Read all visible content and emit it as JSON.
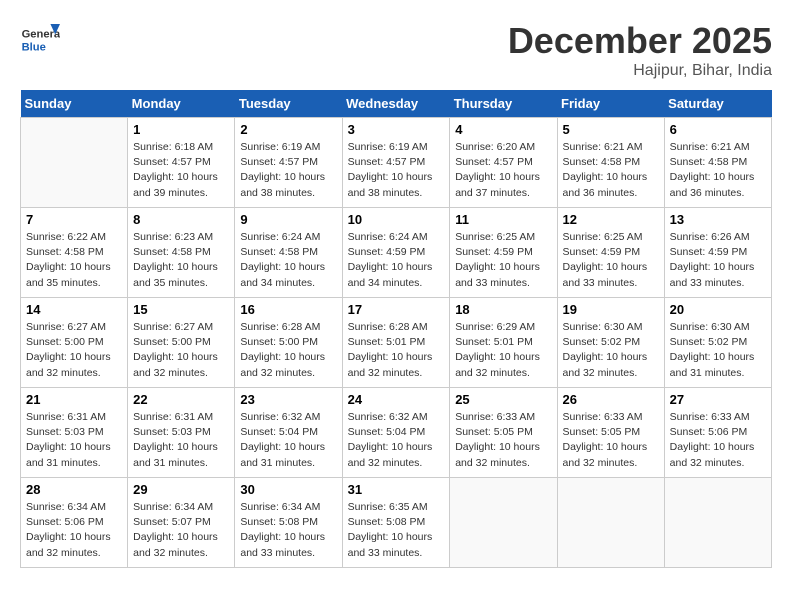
{
  "header": {
    "logo_line1": "General",
    "logo_line2": "Blue",
    "month": "December 2025",
    "location": "Hajipur, Bihar, India"
  },
  "weekdays": [
    "Sunday",
    "Monday",
    "Tuesday",
    "Wednesday",
    "Thursday",
    "Friday",
    "Saturday"
  ],
  "weeks": [
    [
      {
        "day": null
      },
      {
        "day": "1",
        "sunrise": "6:18 AM",
        "sunset": "4:57 PM",
        "daylight": "10 hours and 39 minutes."
      },
      {
        "day": "2",
        "sunrise": "6:19 AM",
        "sunset": "4:57 PM",
        "daylight": "10 hours and 38 minutes."
      },
      {
        "day": "3",
        "sunrise": "6:19 AM",
        "sunset": "4:57 PM",
        "daylight": "10 hours and 38 minutes."
      },
      {
        "day": "4",
        "sunrise": "6:20 AM",
        "sunset": "4:57 PM",
        "daylight": "10 hours and 37 minutes."
      },
      {
        "day": "5",
        "sunrise": "6:21 AM",
        "sunset": "4:58 PM",
        "daylight": "10 hours and 36 minutes."
      },
      {
        "day": "6",
        "sunrise": "6:21 AM",
        "sunset": "4:58 PM",
        "daylight": "10 hours and 36 minutes."
      }
    ],
    [
      {
        "day": "7",
        "sunrise": "6:22 AM",
        "sunset": "4:58 PM",
        "daylight": "10 hours and 35 minutes."
      },
      {
        "day": "8",
        "sunrise": "6:23 AM",
        "sunset": "4:58 PM",
        "daylight": "10 hours and 35 minutes."
      },
      {
        "day": "9",
        "sunrise": "6:24 AM",
        "sunset": "4:58 PM",
        "daylight": "10 hours and 34 minutes."
      },
      {
        "day": "10",
        "sunrise": "6:24 AM",
        "sunset": "4:59 PM",
        "daylight": "10 hours and 34 minutes."
      },
      {
        "day": "11",
        "sunrise": "6:25 AM",
        "sunset": "4:59 PM",
        "daylight": "10 hours and 33 minutes."
      },
      {
        "day": "12",
        "sunrise": "6:25 AM",
        "sunset": "4:59 PM",
        "daylight": "10 hours and 33 minutes."
      },
      {
        "day": "13",
        "sunrise": "6:26 AM",
        "sunset": "4:59 PM",
        "daylight": "10 hours and 33 minutes."
      }
    ],
    [
      {
        "day": "14",
        "sunrise": "6:27 AM",
        "sunset": "5:00 PM",
        "daylight": "10 hours and 32 minutes."
      },
      {
        "day": "15",
        "sunrise": "6:27 AM",
        "sunset": "5:00 PM",
        "daylight": "10 hours and 32 minutes."
      },
      {
        "day": "16",
        "sunrise": "6:28 AM",
        "sunset": "5:00 PM",
        "daylight": "10 hours and 32 minutes."
      },
      {
        "day": "17",
        "sunrise": "6:28 AM",
        "sunset": "5:01 PM",
        "daylight": "10 hours and 32 minutes."
      },
      {
        "day": "18",
        "sunrise": "6:29 AM",
        "sunset": "5:01 PM",
        "daylight": "10 hours and 32 minutes."
      },
      {
        "day": "19",
        "sunrise": "6:30 AM",
        "sunset": "5:02 PM",
        "daylight": "10 hours and 32 minutes."
      },
      {
        "day": "20",
        "sunrise": "6:30 AM",
        "sunset": "5:02 PM",
        "daylight": "10 hours and 31 minutes."
      }
    ],
    [
      {
        "day": "21",
        "sunrise": "6:31 AM",
        "sunset": "5:03 PM",
        "daylight": "10 hours and 31 minutes."
      },
      {
        "day": "22",
        "sunrise": "6:31 AM",
        "sunset": "5:03 PM",
        "daylight": "10 hours and 31 minutes."
      },
      {
        "day": "23",
        "sunrise": "6:32 AM",
        "sunset": "5:04 PM",
        "daylight": "10 hours and 31 minutes."
      },
      {
        "day": "24",
        "sunrise": "6:32 AM",
        "sunset": "5:04 PM",
        "daylight": "10 hours and 32 minutes."
      },
      {
        "day": "25",
        "sunrise": "6:33 AM",
        "sunset": "5:05 PM",
        "daylight": "10 hours and 32 minutes."
      },
      {
        "day": "26",
        "sunrise": "6:33 AM",
        "sunset": "5:05 PM",
        "daylight": "10 hours and 32 minutes."
      },
      {
        "day": "27",
        "sunrise": "6:33 AM",
        "sunset": "5:06 PM",
        "daylight": "10 hours and 32 minutes."
      }
    ],
    [
      {
        "day": "28",
        "sunrise": "6:34 AM",
        "sunset": "5:06 PM",
        "daylight": "10 hours and 32 minutes."
      },
      {
        "day": "29",
        "sunrise": "6:34 AM",
        "sunset": "5:07 PM",
        "daylight": "10 hours and 32 minutes."
      },
      {
        "day": "30",
        "sunrise": "6:34 AM",
        "sunset": "5:08 PM",
        "daylight": "10 hours and 33 minutes."
      },
      {
        "day": "31",
        "sunrise": "6:35 AM",
        "sunset": "5:08 PM",
        "daylight": "10 hours and 33 minutes."
      },
      {
        "day": null
      },
      {
        "day": null
      },
      {
        "day": null
      }
    ]
  ],
  "labels": {
    "sunrise_prefix": "Sunrise: ",
    "sunset_prefix": "Sunset: ",
    "daylight_prefix": "Daylight: "
  }
}
